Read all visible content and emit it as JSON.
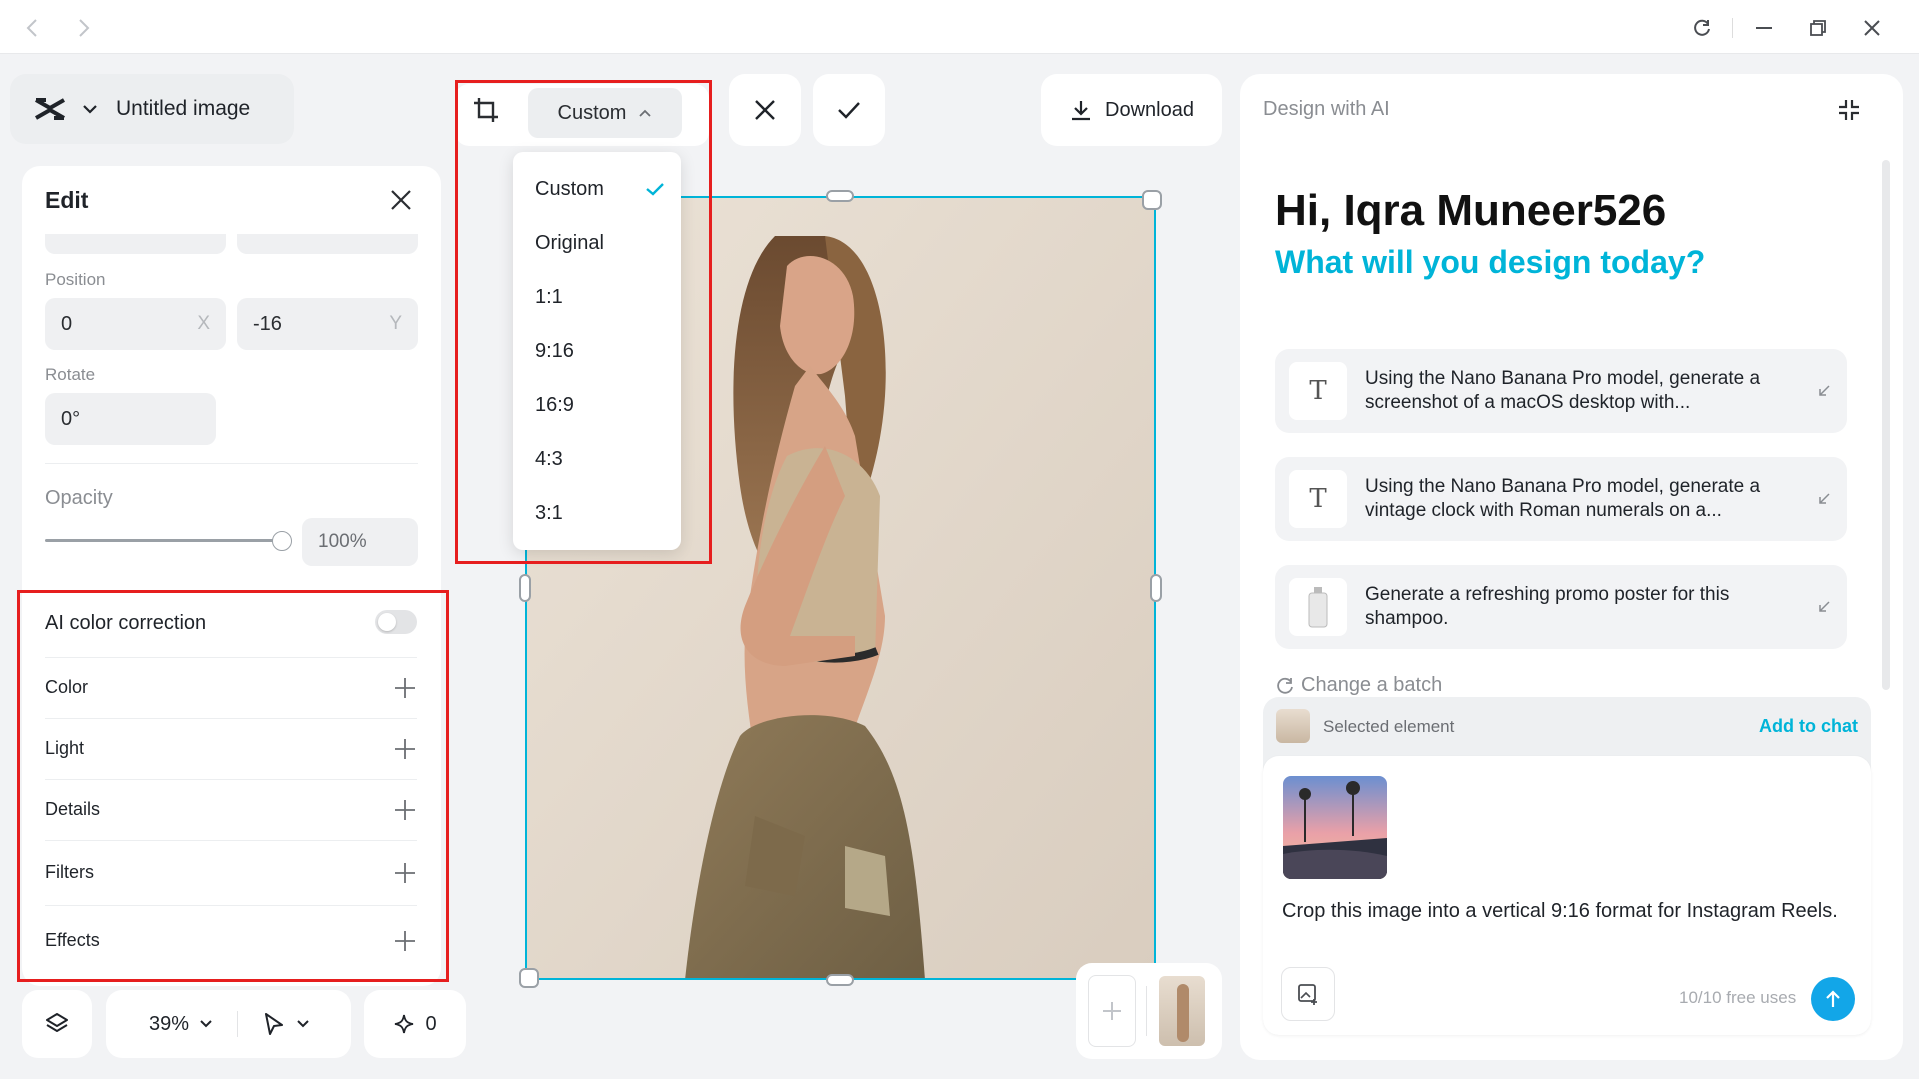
{
  "window": {
    "nav_back": "back-arrow-icon",
    "nav_forward": "forward-arrow-icon",
    "controls": [
      "refresh-icon",
      "minimize-icon",
      "restore-icon",
      "close-icon"
    ]
  },
  "header": {
    "doc_title": "Untitled image",
    "logo": "capcut-logo-icon"
  },
  "edit_panel": {
    "title": "Edit",
    "position_label": "Position",
    "position_x": "0",
    "position_x_axis": "X",
    "position_y": "-16",
    "position_y_axis": "Y",
    "rotate_label": "Rotate",
    "rotate_value": "0°",
    "opacity_label": "Opacity",
    "opacity_value": "100%",
    "opacity_level": 1.0,
    "ai_color_correction": "AI color correction",
    "ai_color_enabled": false,
    "sections": [
      "Color",
      "Light",
      "Details",
      "Filters",
      "Effects"
    ]
  },
  "bottom_toolbar": {
    "zoom": "39%",
    "credits": "0"
  },
  "crop": {
    "selected": "Custom",
    "options": [
      "Custom",
      "Original",
      "1:1",
      "9:16",
      "16:9",
      "4:3",
      "3:1"
    ]
  },
  "toolbar": {
    "download_label": "Download"
  },
  "ai_panel": {
    "title": "Design with AI",
    "greeting": "Hi, Iqra Muneer526",
    "subtitle": "What will you design today?",
    "suggestions": [
      "Using the Nano Banana Pro model, generate a screenshot of a macOS desktop with...",
      "Using the Nano Banana Pro model, generate a vintage clock with Roman numerals on a...",
      "Generate a refreshing promo poster for this shampoo."
    ],
    "change_batch": "Change a batch",
    "selected_element": "Selected element",
    "add_to_chat": "Add to chat",
    "prompt_text": "Crop this image into a vertical 9:16 format for Instagram Reels.",
    "free_uses": "10/10 free uses"
  },
  "colors": {
    "accent": "#00b4d8",
    "highlight_box": "#e61e1e",
    "send_button": "#12a6e8"
  }
}
